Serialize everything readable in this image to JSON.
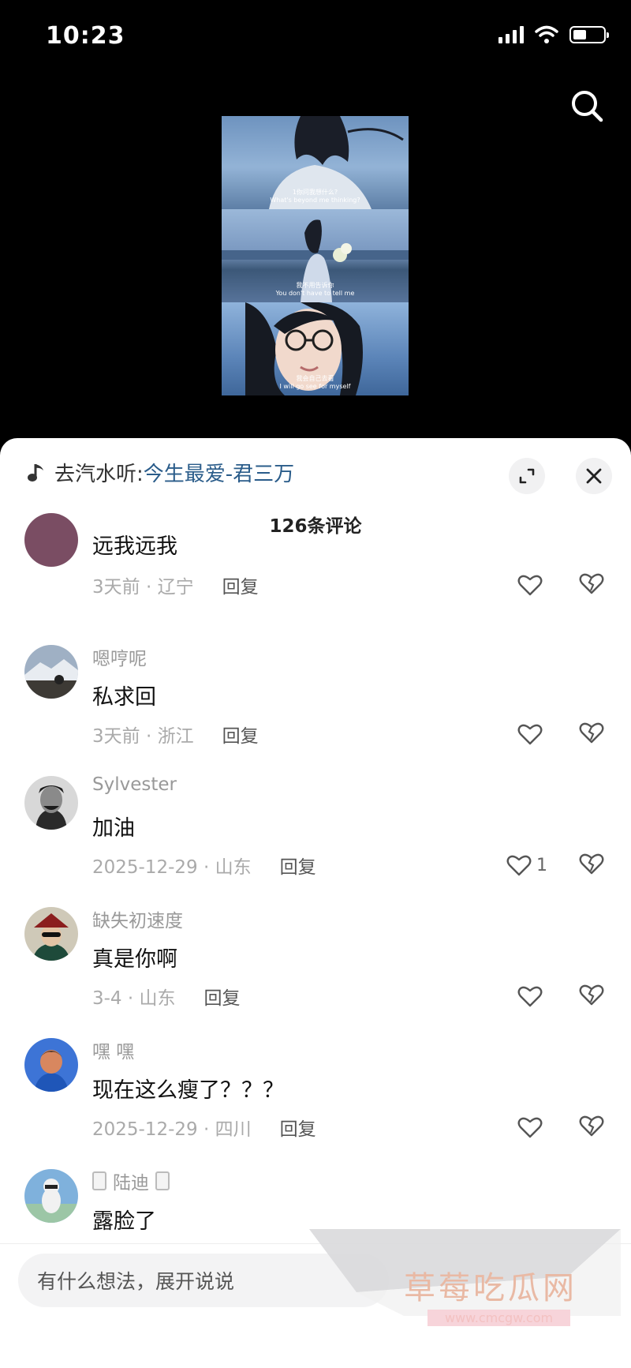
{
  "status": {
    "time": "10:23"
  },
  "video": {
    "captions": [
      {
        "cn": "1你问我想什么?",
        "en": "What's beyond me thinking?"
      },
      {
        "cn": "我不用告诉你",
        "en": "You don't have to tell me"
      },
      {
        "cn": "我会自己去看",
        "en": "I will go see for myself"
      }
    ]
  },
  "music": {
    "prefix": "去汽水听:",
    "song": "今生最爱-君三万"
  },
  "comment_count": "126条评论",
  "comments": [
    {
      "user": "",
      "text": "远我远我",
      "time": "3天前 · 辽宁",
      "reply": "回复",
      "likes": ""
    },
    {
      "user": "嗯哼呢",
      "text": "私求回",
      "time": "3天前 · 浙江",
      "reply": "回复",
      "likes": ""
    },
    {
      "user": "Sylvester",
      "text": "加油",
      "time": "2025-12-29 · 山东",
      "reply": "回复",
      "likes": "1"
    },
    {
      "user": "缺失初速度",
      "text": "真是你啊",
      "time": "3-4 · 山东",
      "reply": "回复",
      "likes": ""
    },
    {
      "user": "嘿 嘿",
      "text": "现在这么瘦了？？？",
      "time": "2025-12-29 · 四川",
      "reply": "回复",
      "likes": ""
    },
    {
      "user": "陆迪",
      "text": "露脸了",
      "time": "",
      "reply": "",
      "likes": ""
    }
  ],
  "input": {
    "placeholder": "有什么想法，展开说说"
  },
  "watermark": {
    "title": "草莓吃瓜网",
    "url": "www.cmcgw.com"
  },
  "icons": [
    "search-icon",
    "music-note-icon",
    "expand-icon",
    "close-icon",
    "heart-icon",
    "broken-heart-icon"
  ],
  "colors": {
    "accent_link": "#2a5c8a",
    "background": "#000000",
    "sheet": "#ffffff"
  }
}
